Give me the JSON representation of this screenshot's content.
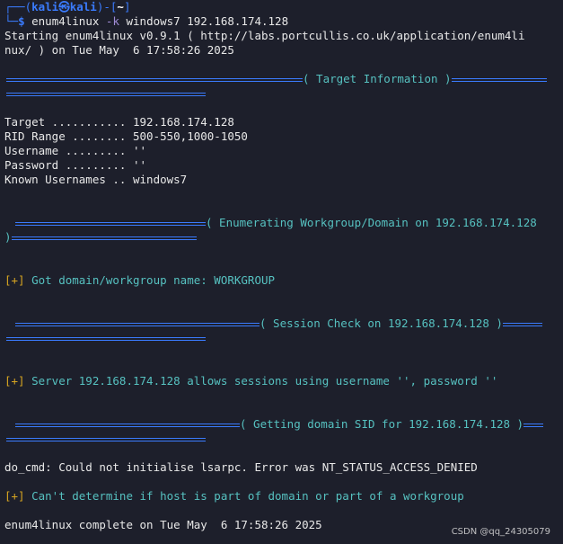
{
  "prompt": {
    "corner_top": "┌──(",
    "user": "kali㉿kali",
    "close_open": ")-[",
    "dir": "~",
    "close": "]",
    "corner_bottom": "└─",
    "dollar": "$ ",
    "cmd": "enum4linux",
    "flag": " -k",
    "args": " windows7 192.168.174.128"
  },
  "lines": {
    "start1": "Starting enum4linux v0.9.1 ( http://labs.portcullis.co.uk/application/enum4li",
    "start2": "nux/ ) on Tue May  6 17:58:26 2025",
    "sec_target": "( Target Information )",
    "target": "Target ........... 192.168.174.128",
    "rid": "RID Range ........ 500-550,1000-1050",
    "username": "Username ......... ''",
    "password": "Password ......... ''",
    "known": "Known Usernames .. windows7",
    "sec_enum": "( Enumerating Workgroup/Domain on 192.168.174.128",
    "sec_enum_close": ")",
    "plus": "[+]",
    "got_domain": " Got domain/workgroup name: WORKGROUP",
    "sec_session": "( Session Check on 192.168.174.128 )",
    "server_allows": " Server 192.168.174.128 allows sessions using username '', password ''",
    "sec_sid": "( Getting domain SID for 192.168.174.128 )",
    "do_cmd": "do_cmd: Could not initialise lsarpc. Error was NT_STATUS_ACCESS_DENIED",
    "cant_determine": " Can't determine if host is part of domain or part of a workgroup",
    "complete": "enum4linux complete on Tue May  6 17:58:26 2025"
  },
  "watermark": "CSDN @qq_24305079",
  "colors": {
    "background": "#1d1f2b",
    "rule": "#3a7bfd",
    "section_text": "#56c1c0",
    "plus": "#d7a521"
  }
}
